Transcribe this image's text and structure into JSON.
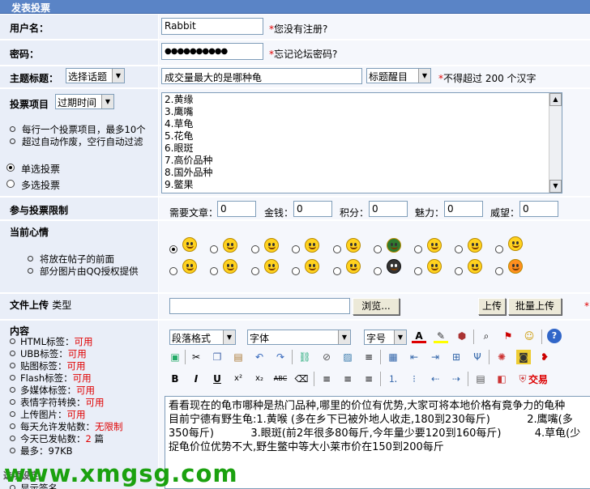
{
  "header": {
    "title": "发表投票"
  },
  "username": {
    "label": "用户名：",
    "value": "Rabbit",
    "star": "*",
    "hint": "您没有注册?"
  },
  "password": {
    "label": "密码：",
    "value": "●●●●●●●●●●",
    "star": "*",
    "hint": "忘记论坛密码?"
  },
  "subject": {
    "label": "主题标题：",
    "topic_select": "选择话题",
    "value": "成交量最大的是哪种龟",
    "style_select": "标题醒目",
    "star": "*",
    "hint": "不得超过 200 个汉字"
  },
  "vote_items": {
    "label": "投票项目",
    "expire_select": "过期时间",
    "tips": [
      "每行一个投票项目，最多10个",
      "超过自动作废，空行自动过滤"
    ],
    "single": "单选投票",
    "multi": "多选投票",
    "lines": [
      "2.黄缘",
      "3.鹰嘴",
      "4.草龟",
      "5.花龟",
      "6.眼斑",
      "7.高价品种",
      "8.国外品种",
      " 9.鳖果"
    ]
  },
  "limits": {
    "label": "参与投票限制",
    "fields": [
      {
        "label": "需要文章：",
        "value": "0"
      },
      {
        "label": "金钱：",
        "value": "0"
      },
      {
        "label": "积分：",
        "value": "0"
      },
      {
        "label": "魅力：",
        "value": "0"
      },
      {
        "label": "威望：",
        "value": "0"
      }
    ]
  },
  "mood": {
    "label": "当前心情",
    "tips": [
      "将放在帖子的前面",
      "部分图片由QQ授权提供"
    ]
  },
  "upload": {
    "label": "文件上传",
    "type_label": "类型",
    "browse": "浏览...",
    "upload": "上传",
    "batch_upload": "批量上传",
    "star": "*"
  },
  "content": {
    "label": "内容",
    "items": [
      {
        "name": "HTML标签：",
        "value": "可用"
      },
      {
        "name": "UBB标签：",
        "value": "可用"
      },
      {
        "name": "贴图标签：",
        "value": "可用"
      },
      {
        "name": "Flash标签：",
        "value": "可用"
      },
      {
        "name": "多媒体标签：",
        "value": "可用"
      },
      {
        "name": "表情字符转换：",
        "value": "可用"
      },
      {
        "name": "上传图片：",
        "value": "可用"
      },
      {
        "name": "每天允许发帖数：",
        "value": "无限制"
      },
      {
        "name": "今天已发帖数：",
        "value": "2",
        "suffix": " 篇"
      },
      {
        "name": "最多：",
        "value": "97KB"
      }
    ],
    "tail": "选项设定",
    "tail2": "显示签名"
  },
  "toolbar": {
    "paragraph": "段落格式",
    "font": "字体",
    "size": "字号",
    "trade": "交易"
  },
  "editor": {
    "lines": [
      "看看现在的龟市哪种是热门品种,哪里的价位有优势,大家可将本地价格有竟争力的龟种",
      "目前宁德有野生龟:1.黄喉 (多在乡下已被外地人收走,180到230每斤)           2.鹰嘴(多",
      "350每斤)           3.眼斑(前2年很多80每斤,今年量少要120到160每斤)          4.草龟(少",
      "捉龟价位优势不大,野生鳖中等大小莱市价在150到200每斤"
    ]
  },
  "watermark": "www.xmgsg.com",
  "colors": {
    "header": "#5a84c6",
    "label_bg": "#e9eef8",
    "accent_red": "#e00000",
    "watermark": "#1ba10f"
  }
}
